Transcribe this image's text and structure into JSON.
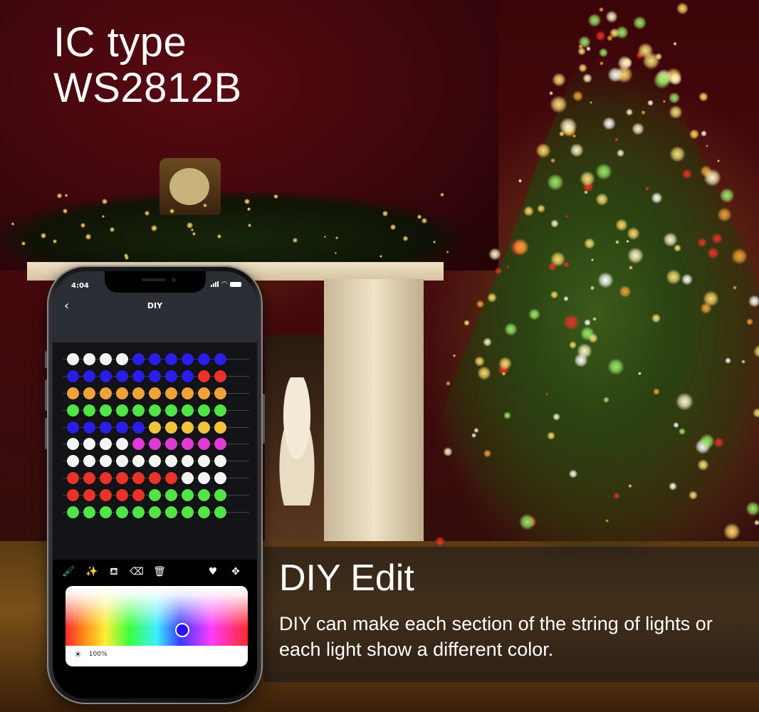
{
  "headline": {
    "line1": "IC type",
    "line2": "WS2812B"
  },
  "feature": {
    "title": "DIY Edit",
    "description": "DIY can make each section of the string of lights or each light show a different color."
  },
  "phone": {
    "status_bar": {
      "time": "4:04",
      "icons": [
        "signal-icon",
        "wifi-icon",
        "battery-icon"
      ]
    },
    "nav": {
      "back_icon": "chevron-left-icon",
      "back_glyph": "‹",
      "title": "DIY"
    },
    "colors": {
      "W": "#f4f4f4",
      "B": "#2a1ee6",
      "R": "#e8322a",
      "O": "#eea23a",
      "G": "#52e346",
      "Y": "#f2c43c",
      "M": "#df3ad6"
    },
    "led_grid": [
      [
        "W",
        "W",
        "W",
        "W",
        "B",
        "B",
        "B",
        "B",
        "B",
        "B"
      ],
      [
        "B",
        "B",
        "B",
        "B",
        "B",
        "B",
        "B",
        "B",
        "R",
        "R"
      ],
      [
        "O",
        "O",
        "O",
        "O",
        "O",
        "O",
        "O",
        "O",
        "O",
        "O"
      ],
      [
        "G",
        "G",
        "G",
        "G",
        "G",
        "G",
        "G",
        "G",
        "G",
        "G"
      ],
      [
        "B",
        "B",
        "B",
        "B",
        "B",
        "Y",
        "Y",
        "Y",
        "Y",
        "Y"
      ],
      [
        "W",
        "W",
        "W",
        "W",
        "M",
        "M",
        "M",
        "M",
        "M",
        "M"
      ],
      [
        "W",
        "W",
        "W",
        "W",
        "W",
        "W",
        "W",
        "W",
        "W",
        "W"
      ],
      [
        "R",
        "R",
        "R",
        "R",
        "R",
        "R",
        "R",
        "W",
        "W",
        "W"
      ],
      [
        "R",
        "R",
        "R",
        "R",
        "R",
        "G",
        "G",
        "G",
        "G",
        "G"
      ],
      [
        "G",
        "G",
        "G",
        "G",
        "G",
        "G",
        "G",
        "G",
        "G",
        "G"
      ]
    ],
    "toolbar": {
      "tools": [
        {
          "name": "brush-tool",
          "glyph": "🖌",
          "active": true,
          "active_color": "#3ec9a6"
        },
        {
          "name": "magic-wand-tool",
          "glyph": "✨",
          "active": false
        },
        {
          "name": "fill-bucket-tool",
          "glyph": "⛾",
          "active": false
        },
        {
          "name": "eraser-tool",
          "glyph": "⌫",
          "active": false
        },
        {
          "name": "trash-tool",
          "glyph": "🗑",
          "active": false
        },
        {
          "name": "favorite-tool",
          "glyph": "♥",
          "active": false
        },
        {
          "name": "move-tool",
          "glyph": "✥",
          "active": false
        }
      ]
    },
    "color_picker": {
      "selected_color": "#2a10ff",
      "brightness_icon": "☀",
      "brightness": "100%"
    }
  }
}
